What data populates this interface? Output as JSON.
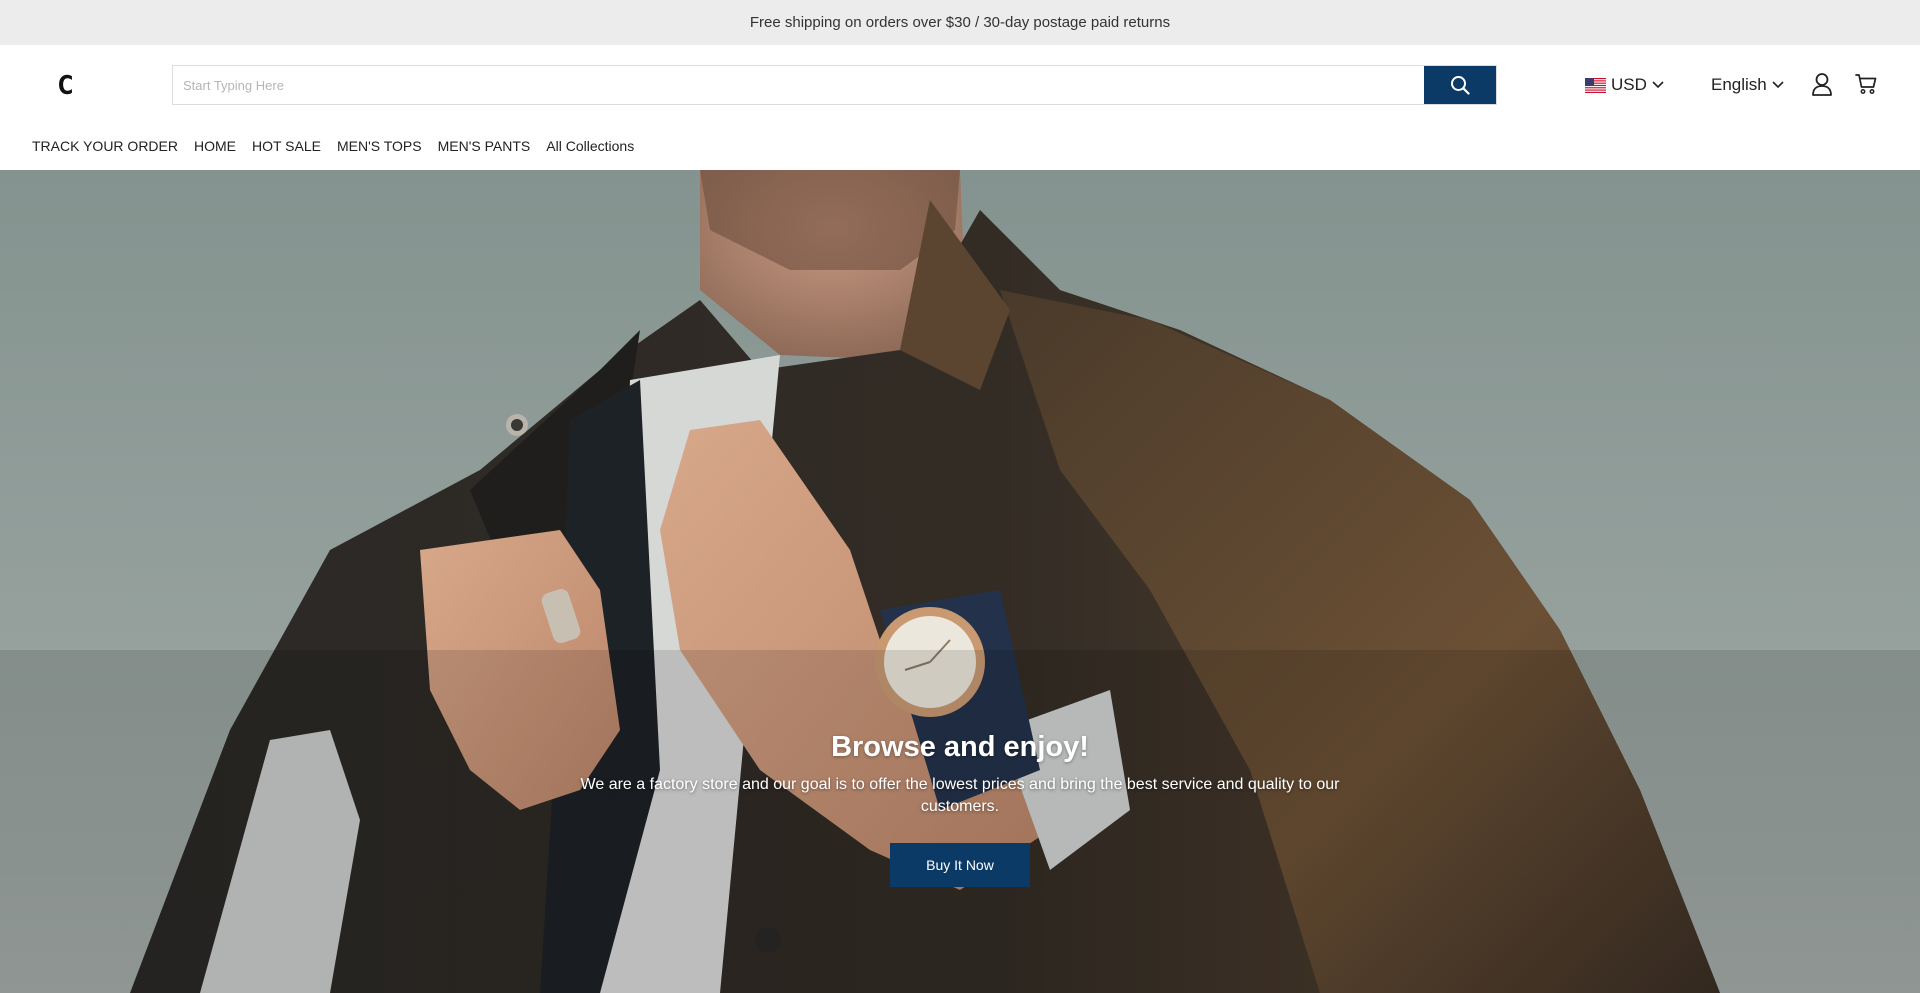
{
  "announcement": {
    "text": "Free shipping on orders over $30 / 30-day postage paid returns",
    "icon_left": "",
    "icon_right": ""
  },
  "header": {
    "logo": "C",
    "search": {
      "placeholder": "Start Typing Here",
      "value": "",
      "button_icon": "search-icon"
    },
    "currency": {
      "flag": "us-flag-icon",
      "label": "USD"
    },
    "language": {
      "label": "English"
    },
    "icons": [
      "user-icon",
      "cart-icon"
    ]
  },
  "nav": {
    "items": [
      {
        "label": "TRACK YOUR ORDER"
      },
      {
        "label": "HOME"
      },
      {
        "label": "HOT SALE"
      },
      {
        "label": "MEN'S TOPS"
      },
      {
        "label": "MEN'S PANTS"
      },
      {
        "label": "All Collections"
      }
    ]
  },
  "hero": {
    "title": "Browse and enjoy!",
    "subtitle": "We are a factory store and our goal is to offer the lowest prices and bring the best service and quality to our customers.",
    "button_label": "Buy It Now"
  },
  "colors": {
    "accent": "#0c3a66",
    "announcement_bg": "#ececec",
    "hero_sky": "#94a09d"
  }
}
